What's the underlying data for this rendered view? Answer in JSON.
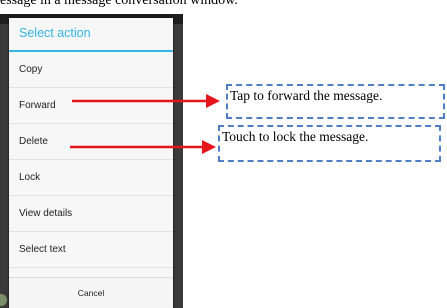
{
  "caption": "essage in a message conversation window.",
  "dialog": {
    "title": "Select action",
    "items": [
      {
        "label": "Copy"
      },
      {
        "label": "Forward"
      },
      {
        "label": "Delete"
      },
      {
        "label": "Lock"
      },
      {
        "label": "View details"
      },
      {
        "label": "Select text"
      }
    ],
    "cancel_label": "Cancel"
  },
  "callouts": {
    "forward": "Tap to forward the message.",
    "lock": "Touch to lock the message."
  },
  "colors": {
    "accent": "#33b5e5",
    "arrow": "#e8141c",
    "callout_border": "#4f7ec6"
  }
}
